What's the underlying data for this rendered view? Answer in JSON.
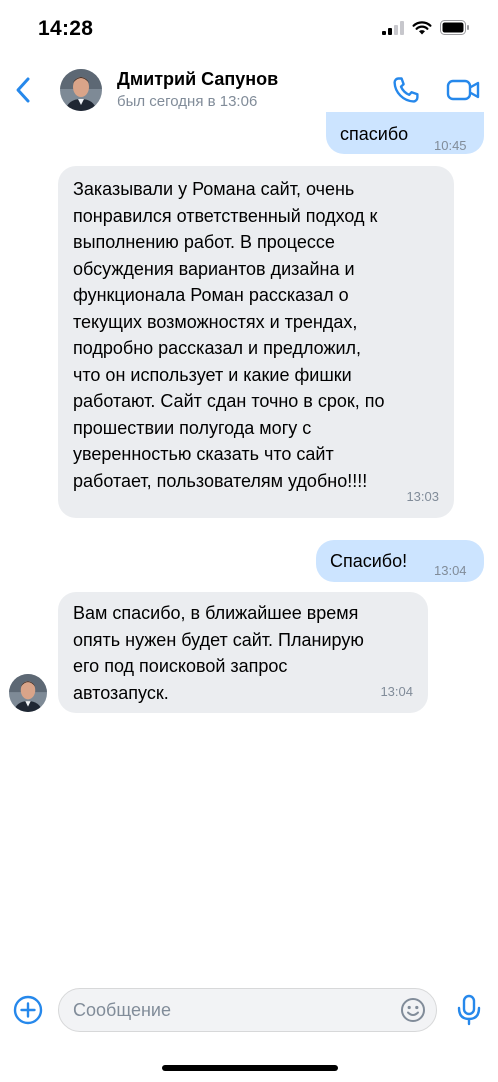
{
  "status_bar": {
    "time": "14:28"
  },
  "header": {
    "contact_name": "Дмитрий Сапунов",
    "contact_status": "был сегодня в 13:06"
  },
  "messages": [
    {
      "direction": "out",
      "text": "спасибо",
      "time": "10:45"
    },
    {
      "direction": "in",
      "text": "Заказывали у Романа сайт, очень\nпонравился ответственный подход к\nвыполнению работ. В процессе\nобсуждения вариантов дизайна и\nфункционала Роман рассказал о\nтекущих возможностях и трендах,\nподробно рассказал и предложил,\nчто он использует и какие фишки\nработают. Сайт сдан точно в срок, по\nпрошествии полугода могу с\nуверенностью сказать что сайт\nработает, пользователям удобно!!!!",
      "time": "13:03"
    },
    {
      "direction": "out",
      "text": "Спасибо!",
      "time": "13:04"
    },
    {
      "direction": "in",
      "text": "Вам спасибо, в ближайшее время\nопять нужен будет сайт. Планирую\nего под поисковой запрос\nавтозапуск.",
      "time": "13:04"
    }
  ],
  "composer": {
    "placeholder": "Сообщение"
  },
  "colors": {
    "accent": "#2688eb",
    "outgoing_bubble": "#cce4ff",
    "incoming_bubble": "#ebedf0",
    "secondary_text": "#818c99"
  },
  "icons": {
    "back": "chevron-left-icon",
    "call": "phone-icon",
    "video": "video-camera-icon",
    "attach": "plus-circle-icon",
    "emoji": "smile-icon",
    "mic": "microphone-icon"
  }
}
